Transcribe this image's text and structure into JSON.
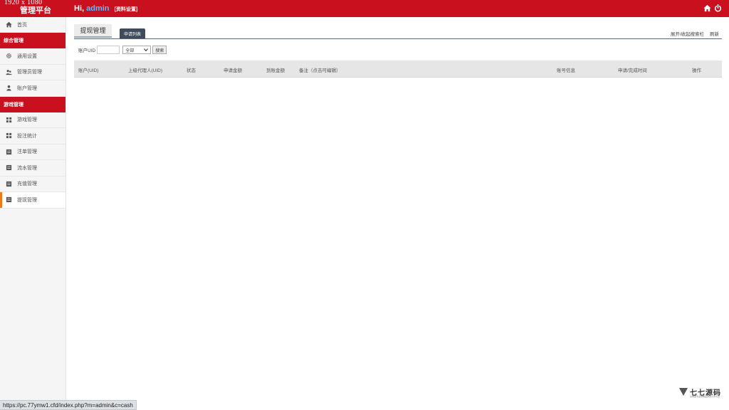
{
  "header": {
    "resolution": "1920 x 1080",
    "brand": "管理平台",
    "greeting_prefix": "Hi, ",
    "username": "admin",
    "profile_link": "[资料设置]",
    "home_icon": "home-icon",
    "power_icon": "power-icon"
  },
  "sidebar": {
    "home": "首页",
    "section_general": "综合管理",
    "general_items": [
      "通用设置",
      "管理员管理",
      "账户管理"
    ],
    "section_game": "游戏管理",
    "game_items": [
      "游戏管理",
      "投注统计",
      "注单管理",
      "流水管理",
      "充值管理",
      "提现管理"
    ],
    "active_item": "提现管理"
  },
  "main": {
    "tab_title": "提现管理",
    "sub_tab": "申请列表",
    "top_links": {
      "toggle_search": "展开/收起搜索栏",
      "refresh": "刷新"
    },
    "search": {
      "uid_label": "账户UID",
      "uid_value": "",
      "status_selected": "全部",
      "search_button": "搜索"
    },
    "table_columns": [
      "账户(UID)",
      "上级代理人(UID)",
      "状态",
      "申请金额",
      "到账金额",
      "备注（点击可编辑）",
      "账号信息",
      "申请/完成时间",
      "操作"
    ]
  },
  "watermark": {
    "name": "七七源码",
    "tagline": "全网最专业的精品源码分享平台"
  },
  "statusbar": {
    "url": "https://pc.77ymw1.cfd/index.php?m=admin&c=cash"
  },
  "colors": {
    "header": "#c9101e",
    "section": "#c9101e",
    "active_accent": "#f07b16",
    "sub_tab": "#3f4b5a",
    "username": "#5db8ff"
  }
}
